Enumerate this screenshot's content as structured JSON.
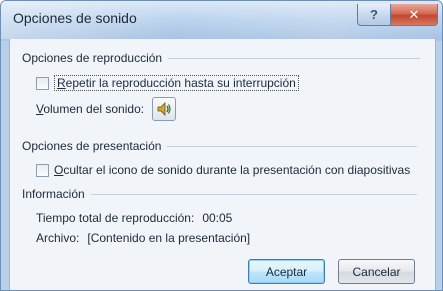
{
  "window": {
    "title": "Opciones de sonido",
    "help_glyph": "?",
    "close_glyph": "✕"
  },
  "playback": {
    "heading": "Opciones de reproducción",
    "loop_accesskey": "R",
    "loop_label_rest": "epetir la reproducción hasta su interrupción",
    "loop_checked": false,
    "volume_accesskey": "V",
    "volume_label_rest": "olumen del sonido:",
    "volume_icon": "speaker-icon"
  },
  "display": {
    "heading": "Opciones de presentación",
    "hide_accesskey": "O",
    "hide_label_rest": "cultar el icono de sonido durante la presentación con diapositivas",
    "hide_checked": false
  },
  "info": {
    "heading": "Información",
    "total_time_label": "Tiempo total de reproducción:",
    "total_time_value": "00:05",
    "file_label": "Archivo:",
    "file_value": "[Contenido en la presentación]"
  },
  "buttons": {
    "ok": "Aceptar",
    "cancel": "Cancelar"
  },
  "colors": {
    "title_bar": "#bcd3ee",
    "close_button": "#c2472e",
    "default_button": "#bee6fd"
  }
}
